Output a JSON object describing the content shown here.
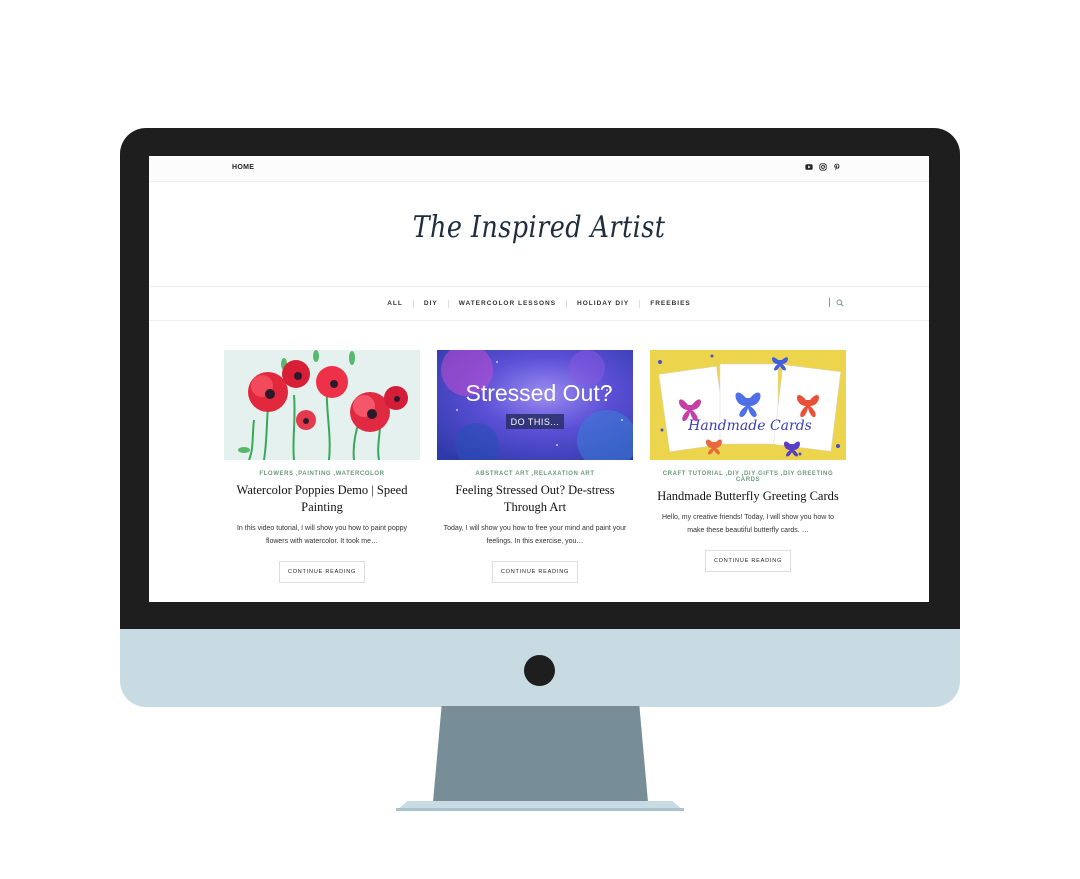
{
  "topbar": {
    "home_label": "HOME",
    "social_icons": [
      "youtube-icon",
      "instagram-icon",
      "pinterest-icon"
    ]
  },
  "site": {
    "logo_text": "The Inspired Artist"
  },
  "nav": {
    "items": [
      {
        "label": "ALL"
      },
      {
        "label": "DIY"
      },
      {
        "label": "WATERCOLOR LESSONS"
      },
      {
        "label": "HOLIDAY DIY"
      },
      {
        "label": "FREEBIES"
      }
    ],
    "search_icon": "search-icon"
  },
  "posts": [
    {
      "categories": "FLOWERS ,PAINTING ,WATERCOLOR",
      "title": "Watercolor Poppies Demo | Speed Painting",
      "excerpt": "In this video tutorial, I will show you how to paint poppy flowers with watercolor. It took me…",
      "cta": "CONTINUE READING"
    },
    {
      "categories": "ABSTRACT ART ,RELAXATION ART",
      "title": "Feeling Stressed Out? De-stress Through Art",
      "excerpt": "Today, I will show you how to free your mind and paint your feelings. In this exercise, you…",
      "cta": "CONTINUE READING",
      "image_text": {
        "headline": "Stressed Out?",
        "sub": "DO THIS..."
      }
    },
    {
      "categories": "CRAFT TUTORIAL ,DIY ,DIY GIFTS ,DIY GREETING CARDS",
      "title": "Handmade Butterfly Greeting Cards",
      "excerpt": "Hello, my creative friends! Today, I will show you how to make these beautiful butterfly cards. …",
      "cta": "CONTINUE READING",
      "image_text": {
        "script": "Handmade Cards"
      }
    }
  ],
  "colors": {
    "bezel": "#1e1e1e",
    "chin": "#c8dbe2",
    "stand": "#778d98",
    "category_accent": "#6a9a7c",
    "title_text": "#111111"
  }
}
